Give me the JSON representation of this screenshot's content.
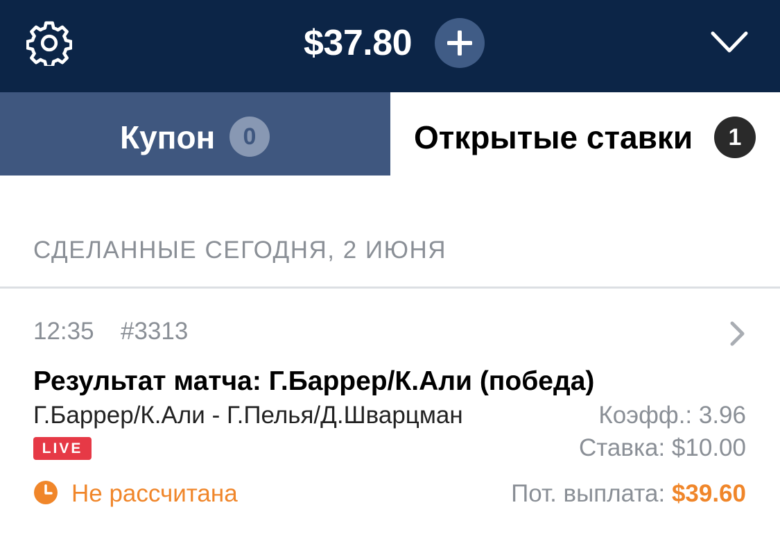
{
  "header": {
    "balance": "$37.80",
    "add_icon": "plus-icon",
    "settings_icon": "gear-icon",
    "collapse_icon": "chevron-down-icon",
    "background": "#0c2547"
  },
  "tabs": [
    {
      "label": "Купон",
      "badge": "0",
      "active": false
    },
    {
      "label": "Открытые ставки",
      "badge": "1",
      "active": true
    }
  ],
  "section": {
    "title": "СДЕЛАННЫЕ СЕГОДНЯ, 2 ИЮНЯ"
  },
  "bet": {
    "time": "12:35",
    "id": "#3313",
    "title": "Результат матча: Г.Баррер/К.Али (победа)",
    "match": "Г.Баррер/К.Али - Г.Пелья/Д.Шварцман",
    "live_label": "LIVE",
    "odds_label": "Коэфф.: 3.96",
    "stake_label": "Ставка: $10.00",
    "status": "Не рассчитана",
    "payout_label": "Пот. выплата:",
    "payout_value": "$39.60",
    "accent_color": "#f0862a",
    "live_color": "#e63946"
  }
}
